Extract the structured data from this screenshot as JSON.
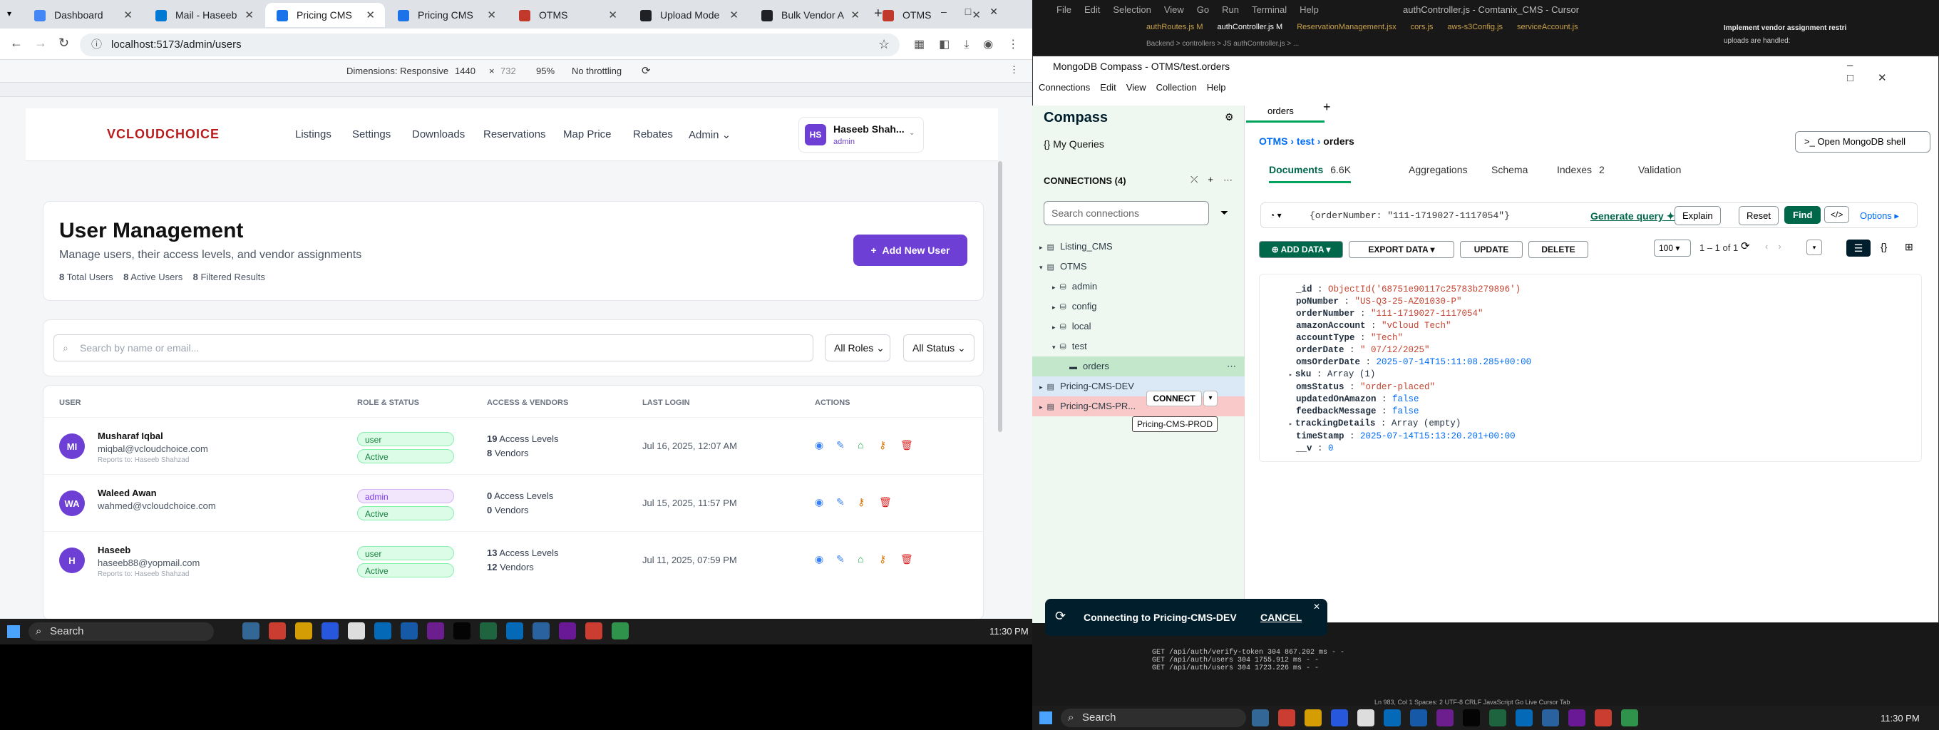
{
  "browser": {
    "tabs": [
      {
        "title": "Dashboard",
        "color": "#4285f4"
      },
      {
        "title": "Mail - Haseeb",
        "color": "#0078d4"
      },
      {
        "title": "Pricing CMS",
        "color": "#1a73e8"
      },
      {
        "title": "Pricing CMS",
        "color": "#1a73e8"
      },
      {
        "title": "OTMS",
        "color": "#c0392b"
      },
      {
        "title": "Upload Mode",
        "color": "#202124"
      },
      {
        "title": "Bulk Vendor A",
        "color": "#202124"
      },
      {
        "title": "OTMS",
        "color": "#c0392b"
      }
    ],
    "url": "localhost:5173/admin/users",
    "devtools": {
      "dims": "Dimensions: Responsive",
      "w": "1440",
      "h": "732",
      "zoom": "95%",
      "throttle": "No throttling"
    }
  },
  "app": {
    "logo": "VCLOUDCHOICE",
    "nav": [
      "Listings",
      "Settings",
      "Downloads",
      "Reservations",
      "Map Price",
      "Rebates",
      "Admin"
    ],
    "user": {
      "initials": "HS",
      "name": "Haseeb Shah...",
      "role": "admin"
    },
    "title": "User Management",
    "subtitle": "Manage users, their access levels, and vendor assignments",
    "stats": [
      {
        "n": "8",
        "l": "Total Users"
      },
      {
        "n": "8",
        "l": "Active Users"
      },
      {
        "n": "8",
        "l": "Filtered Results"
      }
    ],
    "add_btn": "Add New User",
    "search_ph": "Search by name or email...",
    "roles": "All Roles",
    "status": "All Status",
    "cols": [
      "USER",
      "ROLE & STATUS",
      "ACCESS & VENDORS",
      "LAST LOGIN",
      "ACTIONS"
    ],
    "rows": [
      {
        "init": "MI",
        "name": "Musharaf Iqbal",
        "email": "miqbal@vcloudchoice.com",
        "reports": "Reports to: Haseeb Shahzad",
        "role": "user",
        "status": "Active",
        "access": "19",
        "acc_l": "Access Levels",
        "vendors": "8",
        "ven_l": "Vendors",
        "login": "Jul 16, 2025, 12:07 AM"
      },
      {
        "init": "WA",
        "name": "Waleed Awan",
        "email": "wahmed@vcloudchoice.com",
        "reports": "",
        "role": "admin",
        "status": "Active",
        "access": "0",
        "acc_l": "Access Levels",
        "vendors": "0",
        "ven_l": "Vendors",
        "login": "Jul 15, 2025, 11:57 PM"
      },
      {
        "init": "H",
        "name": "Haseeb",
        "email": "haseeb88@yopmail.com",
        "reports": "Reports to: Haseeb Shahzad",
        "role": "user",
        "status": "Active",
        "access": "13",
        "acc_l": "Access Levels",
        "vendors": "12",
        "ven_l": "Vendors",
        "login": "Jul 11, 2025, 07:59 PM"
      }
    ]
  },
  "taskbar": {
    "search": "Search",
    "time": "11:30 PM"
  },
  "ide": {
    "title": "authController.js - Comtanix_CMS - Cursor",
    "menu": [
      "File",
      "Edit",
      "Selection",
      "View",
      "Go",
      "Run",
      "Terminal",
      "Help"
    ],
    "tabs": [
      "authRoutes.js M",
      "authController.js M",
      "ReservationManagement.jsx",
      "cors.js",
      "aws-s3Config.js",
      "serviceAccount.js"
    ],
    "breadcrumb": "Backend > controllers > JS authController.js > ...",
    "chat_title": "Implement vendor assignment restri",
    "chat_sub": "uploads are handled:",
    "terminal": [
      "GET /api/auth/verify-token 304 867.202 ms - -",
      "GET /api/auth/users 304 1755.912 ms - -",
      "GET /api/auth/users 304 1723.226 ms - -"
    ],
    "statusbar": "Ln 983, Col 1   Spaces: 2   UTF-8   CRLF   JavaScript   Go Live   Cursor Tab"
  },
  "compass": {
    "window_title": "MongoDB Compass - OTMS/test.orders",
    "menu": [
      "Connections",
      "Edit",
      "View",
      "Collection",
      "Help"
    ],
    "brand": "Compass",
    "queries": "My Queries",
    "connections": "CONNECTIONS (4)",
    "search_ph": "Search connections",
    "tree": [
      {
        "label": "Listing_CMS",
        "lvl": 0
      },
      {
        "label": "OTMS",
        "lvl": 0
      },
      {
        "label": "admin",
        "lvl": 1
      },
      {
        "label": "config",
        "lvl": 1
      },
      {
        "label": "local",
        "lvl": 1
      },
      {
        "label": "test",
        "lvl": 1
      },
      {
        "label": "orders",
        "lvl": 2
      },
      {
        "label": "Pricing-CMS-DEV",
        "lvl": 0
      },
      {
        "label": "Pricing-CMS-PR...",
        "lvl": 0
      }
    ],
    "connect": "CONNECT",
    "tooltip": "Pricing-CMS-PROD",
    "tab": "orders",
    "crumbs": [
      "OTMS",
      "test",
      "orders"
    ],
    "shell_btn": "Open MongoDB shell",
    "subtabs": [
      {
        "l": "Documents",
        "c": "6.6K"
      },
      {
        "l": "Aggregations",
        "c": ""
      },
      {
        "l": "Schema",
        "c": ""
      },
      {
        "l": "Indexes",
        "c": "2"
      },
      {
        "l": "Validation",
        "c": ""
      }
    ],
    "query": "{orderNumber: \"111-1719027-1117054\"}",
    "gen_query": "Generate query",
    "explain": "Explain",
    "reset": "Reset",
    "find": "Find",
    "options": "Options",
    "actions": [
      "ADD DATA",
      "EXPORT DATA",
      "UPDATE",
      "DELETE"
    ],
    "page_size": "100",
    "count": "1 – 1 of 1",
    "doc": [
      [
        "_id",
        "ObjectId('68751e90117c25783b279896')",
        "s"
      ],
      [
        "poNumber",
        "\"US-Q3-25-AZ01030-P\"",
        "s"
      ],
      [
        "orderNumber",
        "\"111-1719027-1117054\"",
        "s"
      ],
      [
        "amazonAccount",
        "\"vCloud Tech\"",
        "s"
      ],
      [
        "accountType",
        "\"Tech\"",
        "s"
      ],
      [
        "orderDate",
        "\" 07/12/2025\"",
        "s"
      ],
      [
        "omsOrderDate",
        "2025-07-14T15:11:08.285+00:00",
        "n"
      ],
      [
        "sku",
        "Array (1)",
        "k"
      ],
      [
        "omsStatus",
        "\"order-placed\"",
        "s"
      ],
      [
        "updatedOnAmazon",
        "false",
        "n"
      ],
      [
        "feedbackMessage",
        "false",
        "n"
      ],
      [
        "trackingDetails",
        "Array (empty)",
        "k"
      ],
      [
        "timeStamp",
        "2025-07-14T15:13:20.201+00:00",
        "n"
      ],
      [
        "__v",
        "0",
        "n"
      ]
    ],
    "toast": "Connecting to Pricing-CMS-DEV",
    "toast_cancel": "CANCEL"
  }
}
